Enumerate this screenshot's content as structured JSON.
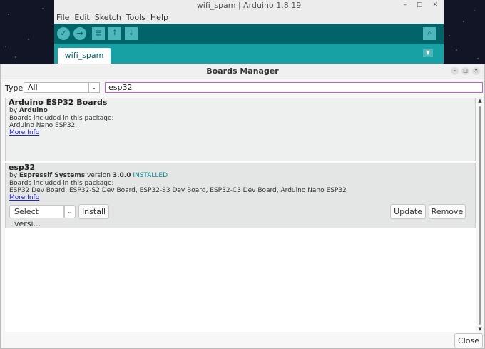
{
  "ide": {
    "title": "wifi_spam | Arduino 1.8.19",
    "menu": [
      "File",
      "Edit",
      "Sketch",
      "Tools",
      "Help"
    ],
    "tab_label": "wifi_spam"
  },
  "dialog": {
    "title": "Boards Manager",
    "type_label": "Type",
    "type_value": "All",
    "search_value": "esp32",
    "close_label": "Close"
  },
  "packages": [
    {
      "name": "Arduino ESP32 Boards",
      "by_prefix": "by",
      "author": "Arduino",
      "included_label": "Boards included in this package:",
      "boards": "Arduino Nano ESP32.",
      "more_info": "More Info"
    },
    {
      "name": "esp32",
      "by_prefix": "by",
      "author": "Espressif Systems",
      "version_label": "version",
      "version": "3.0.0",
      "status": "INSTALLED",
      "included_label": "Boards included in this package:",
      "boards": "ESP32 Dev Board, ESP32-S2 Dev Board, ESP32-S3 Dev Board, ESP32-C3 Dev Board, Arduino Nano ESP32",
      "more_info": "More Info",
      "select_version": "Select versi...",
      "install_label": "Install",
      "update_label": "Update",
      "remove_label": "Remove"
    }
  ],
  "colors": {
    "teal_dark": "#006468",
    "teal": "#17a1a5",
    "installed": "#0e8a8f",
    "search_border": "#c25fc6"
  }
}
